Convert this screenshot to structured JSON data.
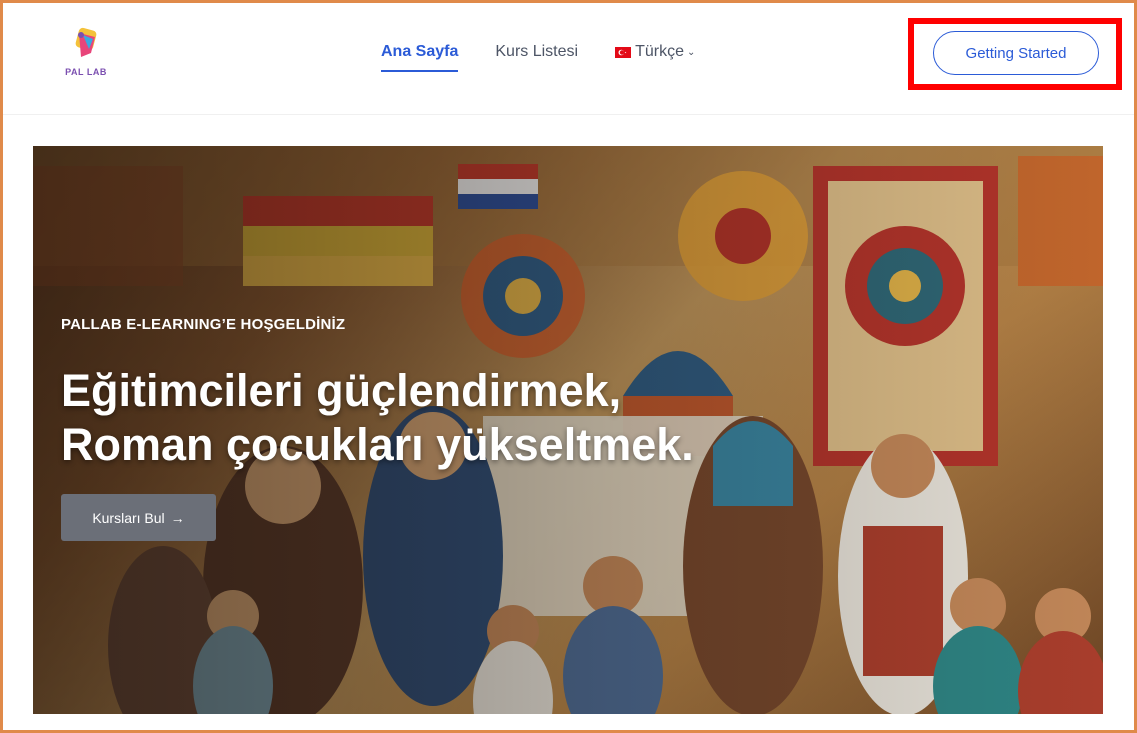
{
  "header": {
    "logo_text": "PAL LAB",
    "nav": [
      {
        "label": "Ana Sayfa",
        "active": true
      },
      {
        "label": "Kurs Listesi",
        "active": false
      },
      {
        "label": "Türkçe",
        "active": false,
        "icon": "turkey-flag-icon",
        "dropdown": true
      }
    ],
    "cta_label": "Getting Started"
  },
  "hero": {
    "kicker": "PALLAB E-LEARNING’E HOŞGELDİNİZ",
    "title_line1": "Eğitimcileri güçlendirmek,",
    "title_line2": "Roman çocukları yükseltmek.",
    "cta_label": "Kursları Bul",
    "cta_icon": "arrow-right-icon"
  },
  "colors": {
    "accent": "#2b5bd7",
    "highlight": "#ff0000",
    "frame": "#e08a4a",
    "cta_bg": "#6b6f78"
  }
}
